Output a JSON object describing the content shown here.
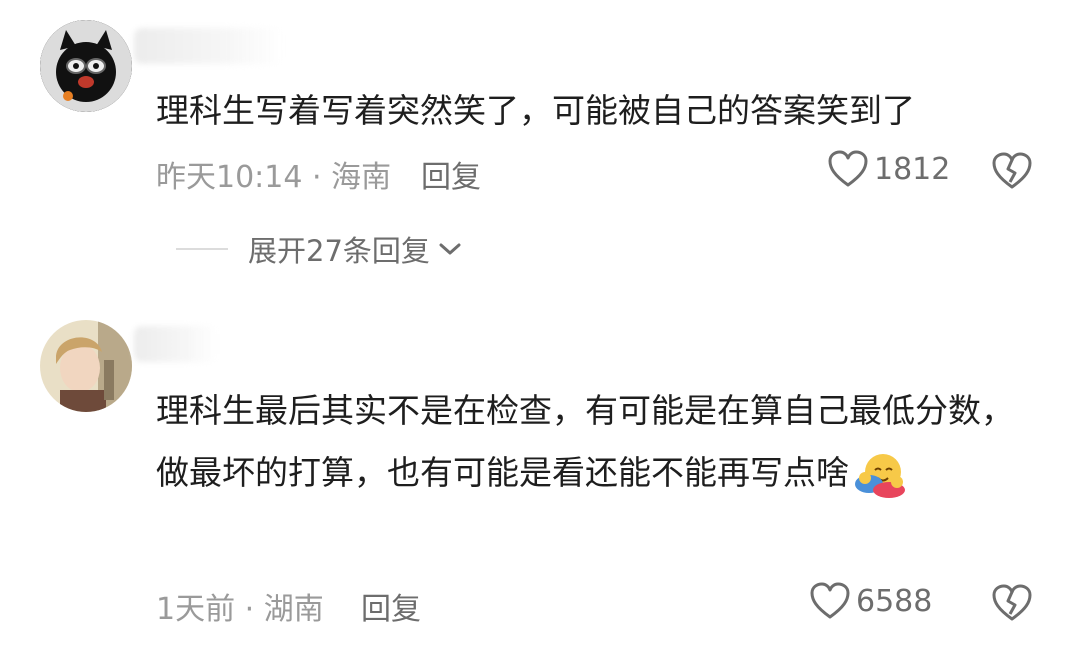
{
  "comments": [
    {
      "text": "理科生写着写着突然笑了，可能被自己的答案笑到了",
      "time_location": "昨天10:14 · 海南",
      "reply_label": "回复",
      "likes": "1812",
      "expand_label": "展开27条回复"
    },
    {
      "text": "理科生最后其实不是在检查，有可能是在算自己最低分数，做最坏的打算，也有可能是看还能不能再写点啥",
      "time_location": "1天前 · 湖南",
      "reply_label": "回复",
      "likes": "6588"
    }
  ],
  "icons": {
    "like": "heart-outline-icon",
    "dislike": "broken-heart-icon",
    "expand": "chevron-down-icon",
    "emoji": "hugging-face-emoji"
  },
  "colors": {
    "text": "#1e1e1e",
    "meta": "#9a9a9a",
    "action": "#6d6d6d"
  }
}
